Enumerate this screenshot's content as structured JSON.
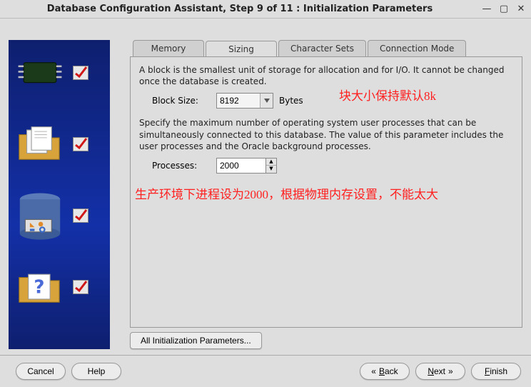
{
  "window": {
    "title": "Database Configuration Assistant, Step 9 of 11 : Initialization Parameters"
  },
  "tabs": {
    "memory": "Memory",
    "sizing": "Sizing",
    "charsets": "Character Sets",
    "connection": "Connection Mode"
  },
  "sizing": {
    "block_desc": "A block is the smallest unit of storage for allocation and for I/O. It cannot be changed once the database is created.",
    "block_size_label": "Block Size:",
    "block_size_value": "8192",
    "block_size_unit": "Bytes",
    "processes_desc": "Specify the maximum number of operating system user processes that can be simultaneously connected to this database. The value of this parameter includes the user processes and the Oracle background processes.",
    "processes_label": "Processes:",
    "processes_value": "2000"
  },
  "annotations": {
    "block_note": "块大小保持默认8k",
    "processes_note": "生产环境下进程设为2000，根据物理内存设置，不能太大"
  },
  "buttons": {
    "all_params": "All Initialization Parameters...",
    "cancel": "Cancel",
    "help": "Help",
    "back": "Back",
    "next": "Next",
    "finish": "Finish"
  }
}
